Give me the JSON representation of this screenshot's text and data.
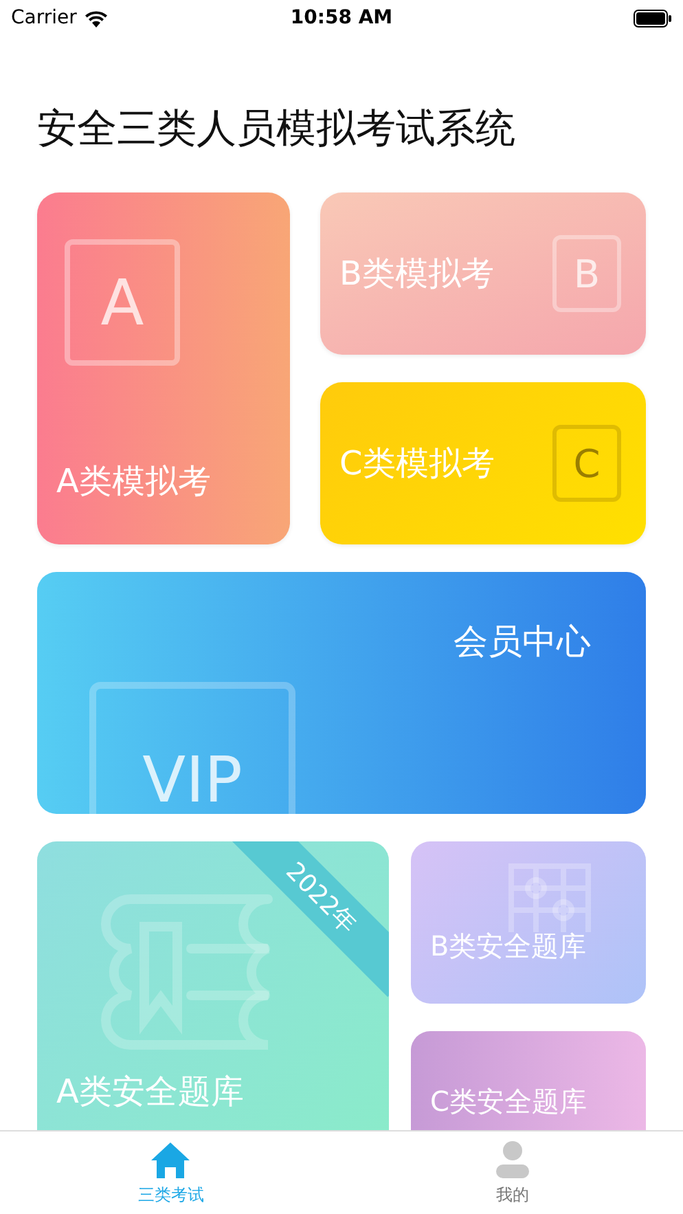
{
  "status_bar": {
    "carrier": "Carrier",
    "time": "10:58 AM"
  },
  "title": "安全三类人员模拟考试系统",
  "exam_cards": [
    {
      "label": "A类模拟考",
      "icon_letter": "A",
      "kind": "tall"
    },
    {
      "label": "B类模拟考",
      "icon_letter": "B",
      "kind": "wide"
    },
    {
      "label": "C类模拟考",
      "icon_letter": "C",
      "kind": "wide"
    }
  ],
  "vip_banner": {
    "label": "会员中心",
    "icon_text": "VIP"
  },
  "question_banks": [
    {
      "label": "A类安全题库",
      "kind": "book",
      "ribbon": "2022年"
    },
    {
      "label": "B类安全题库",
      "kind": "grid"
    },
    {
      "label": "C类安全题库",
      "kind": "plain"
    }
  ],
  "tab_bar": [
    {
      "label": "三类考试",
      "kind": "home",
      "selected": true
    },
    {
      "label": "我的",
      "kind": "person",
      "selected": false
    }
  ]
}
